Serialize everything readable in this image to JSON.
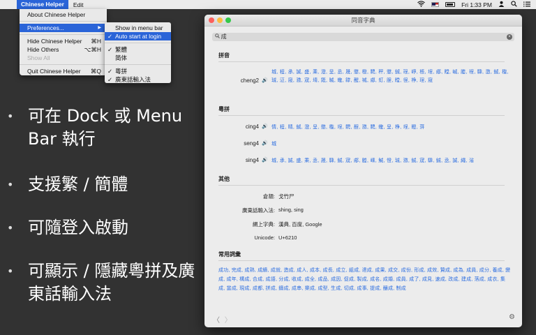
{
  "menubar": {
    "apple": "",
    "app_name": "Chinese Helper",
    "edit": "Edit",
    "clock": "Fri 1:33 PM"
  },
  "app_menu": {
    "about": "About Chinese Helper",
    "preferences": "Preferences...",
    "pref_arrow": "▶",
    "hide": "Hide Chinese Helper",
    "hide_key": "⌘H",
    "hide_others": "Hide Others",
    "hide_others_key": "⌥⌘H",
    "show_all": "Show All",
    "quit": "Quit Chinese Helper",
    "quit_key": "⌘Q"
  },
  "pref_submenu": {
    "show_menu_bar": "Show in menu bar",
    "auto_start": "Auto start at login",
    "traditional": "繁體",
    "simplified": "简体",
    "jyutping": "粵拼",
    "cantonese_input": "廣東話輸入法",
    "check": "✓"
  },
  "slide": {
    "bullet": "•",
    "items": [
      "可在 Dock 或 Menu Bar 執行",
      "支援繁 / 簡體",
      "可隨登入啟動",
      "可顯示 / 隱藏粵拼及廣東話輸入法"
    ]
  },
  "dict": {
    "title": "同音字典",
    "search_icon": "🔍",
    "query": "成",
    "clear": "×",
    "sections": {
      "pinyin": "拼音",
      "jyutping": "粵拼",
      "other": "其他",
      "words": "常用詞彙"
    },
    "speaker": "🔊",
    "pinyin_rows": [
      {
        "label": "cheng2",
        "chars": "城, 程, 承, 誠, 盛, 乘, 澄, 呈, 丞, 晟, 懲, 橙, 騁, 秤, 懲, 鋮, 珵, 崢, 棖, 埕, 郕, 瞠, 峸, 塍, 裎, 騬, 澂, 鋮, 檉, 珹, 泟, 窚, 瀓, 宬, 埥, 筬, 晠, 蟶, 罉, 醒, 祴, 郕, 虰, 脭, 瞠, 徎, 棦, 珵, 窚"
      }
    ],
    "jyutping_rows": [
      {
        "label": "cing4",
        "chars": "情, 程, 晴, 鋮, 澄, 呈, 懲, 檉, 埕, 騁, 酲, 瀓, 騁, 蟶, 呈, 棦, 埕, 瞪, 蓱"
      },
      {
        "label": "seng4",
        "chars": "城"
      },
      {
        "label": "sing4",
        "chars": "城, 承, 誠, 盛, 乘, 丞, 晟, 騬, 鋮, 宬, 郕, 塍, 嵊, 鯎, 憕, 珹, 瀓, 鋮, 宬, 騬, 鋮, 丞, 誠, 繩, 渻"
      }
    ],
    "info": [
      {
        "label": "倉頡:",
        "value": "戈竹尸",
        "link": false
      },
      {
        "label": "廣東話輸入法:",
        "value": "shing, sing",
        "link": true
      },
      {
        "label": "網上字典:",
        "value": "漢典, 百度, Google",
        "link": true
      },
      {
        "label": "Unicode:",
        "value": "U+6210",
        "link": false
      }
    ],
    "words": "成功, 完成, 成熟, 成績, 成就, 造成, 成人, 成本, 成長, 成立, 組成, 達成, 成果, 成交, 成份, 形成, 成效, 贊成, 成為, 成員, 成分, 養成, 變成, 成年, 構成, 合成, 成語, 分成, 收成, 成全, 成品, 成因, 促成, 製成, 成名, 成婚, 成員, 成了, 成見, 速成, 改成, 建成, 落成, 成衣, 集成, 當成, 現成, 成都, 拼成, 鑄成, 成串, 樂成, 成型, 生成, 切成, 成事, 提成, 釀成, 制成",
    "nav_back": "〈",
    "nav_forward": "〉",
    "gear": "⚙"
  }
}
